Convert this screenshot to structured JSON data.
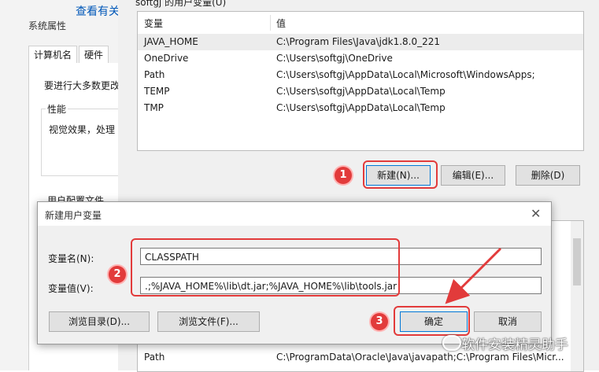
{
  "background_window": {
    "title": "系统属性",
    "tabs": [
      "计算机名",
      "硬件"
    ],
    "message": "要进行大多数更改",
    "performance_group": "性能",
    "performance_text": "视觉效果，处理",
    "profile_text": "用户配置文件",
    "link_fragment": "查看有关"
  },
  "env_dialog": {
    "section_header": "softgj 的用户变量(U)",
    "columns": [
      "变量",
      "值"
    ],
    "user_vars": [
      {
        "name": "JAVA_HOME",
        "value": "C:\\Program Files\\Java\\jdk1.8.0_221"
      },
      {
        "name": "OneDrive",
        "value": "C:\\Users\\softgj\\OneDrive"
      },
      {
        "name": "Path",
        "value": "C:\\Users\\softgj\\AppData\\Local\\Microsoft\\WindowsApps;"
      },
      {
        "name": "TEMP",
        "value": "C:\\Users\\softgj\\AppData\\Local\\Temp"
      },
      {
        "name": "TMP",
        "value": "C:\\Users\\softgj\\AppData\\Local\\Temp"
      }
    ],
    "buttons": {
      "new": "新建(N)...",
      "edit": "编辑(E)...",
      "delete": "删除(D)"
    },
    "system_vars_visible_row": {
      "name": "Path",
      "value": "C:\\ProgramData\\Oracle\\Java\\javapath;C:\\Program Files\\Micr..."
    }
  },
  "new_var_dialog": {
    "title": "新建用户变量",
    "close_glyph": "✕",
    "name_label": "变量名(N):",
    "name_value": "CLASSPATH",
    "value_label": "变量值(V):",
    "value_value": ".;%JAVA_HOME%\\lib\\dt.jar;%JAVA_HOME%\\lib\\tools.jar",
    "browse_dir": "浏览目录(D)...",
    "browse_file": "浏览文件(F)...",
    "ok": "确定",
    "cancel": "取消"
  },
  "annotations": {
    "step1": "1",
    "step2": "2",
    "step3": "3",
    "highlight_color": "#e23b3b"
  },
  "watermark": "软件安装精灵助手"
}
